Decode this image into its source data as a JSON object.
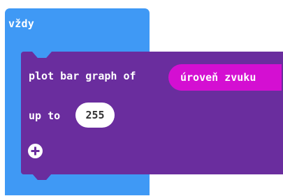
{
  "event_block": {
    "label": "vždy",
    "color": "#3f99f5"
  },
  "plot_block": {
    "line1_label": "plot bar graph of",
    "sound_reporter": "úroveň zvuku",
    "line2_label": "up to",
    "max_value": "255",
    "color": "#6a2d9e",
    "reporter_color": "#d40fd2"
  },
  "icons": {
    "expand": "plus-circle-icon"
  }
}
